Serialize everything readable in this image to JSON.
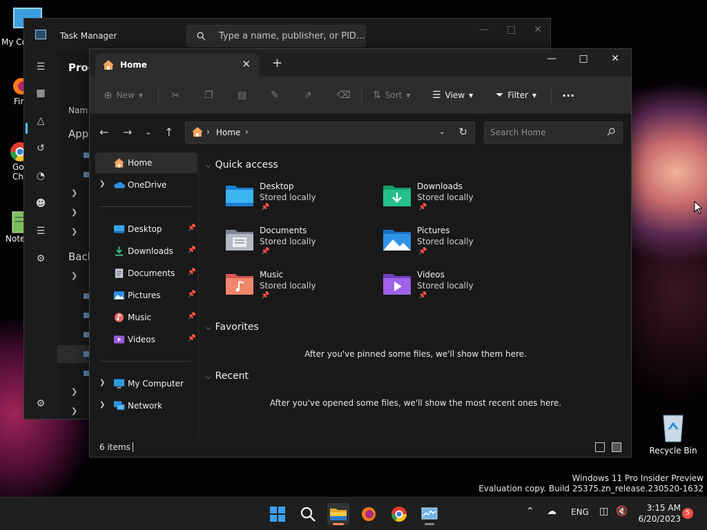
{
  "desktop": {
    "icons": [
      {
        "label": "My Co"
      },
      {
        "label": "Fir"
      },
      {
        "label": "Go Chr"
      },
      {
        "label": "Note"
      },
      {
        "label": "Recycle Bin"
      }
    ]
  },
  "task_manager": {
    "title": "Task Manager",
    "search_placeholder": "Type a name, publisher, or PID...",
    "header": "Proce",
    "column": "Nam",
    "sections": [
      "Apps",
      "Back"
    ]
  },
  "explorer": {
    "tab_title": "Home",
    "toolbar": {
      "new": "New",
      "sort": "Sort",
      "view": "View",
      "filter": "Filter",
      "more": "..."
    },
    "address": {
      "crumb": "Home"
    },
    "search_placeholder": "Search Home",
    "nav": {
      "home": "Home",
      "onedrive": "OneDrive",
      "pinned": [
        "Desktop",
        "Downloads",
        "Documents",
        "Pictures",
        "Music",
        "Videos"
      ],
      "my_computer": "My Computer",
      "network": "Network"
    },
    "quick_access": {
      "title": "Quick access",
      "items": [
        {
          "name": "Desktop",
          "status": "Stored locally"
        },
        {
          "name": "Downloads",
          "status": "Stored locally"
        },
        {
          "name": "Documents",
          "status": "Stored locally"
        },
        {
          "name": "Pictures",
          "status": "Stored locally"
        },
        {
          "name": "Music",
          "status": "Stored locally"
        },
        {
          "name": "Videos",
          "status": "Stored locally"
        }
      ]
    },
    "favorites": {
      "title": "Favorites",
      "empty": "After you've pinned some files, we'll show them here."
    },
    "recent": {
      "title": "Recent",
      "empty": "After you've opened some files, we'll show the most recent ones here."
    },
    "status": {
      "count": "6 items"
    }
  },
  "watermark": {
    "line1": "Windows 11 Pro Insider Preview",
    "line2": "Evaluation copy. Build 25375.zn_release.230520-1632"
  },
  "taskbar": {
    "language": "ENG",
    "time": "3:15 AM",
    "date": "6/20/2023",
    "notifications": "5"
  }
}
